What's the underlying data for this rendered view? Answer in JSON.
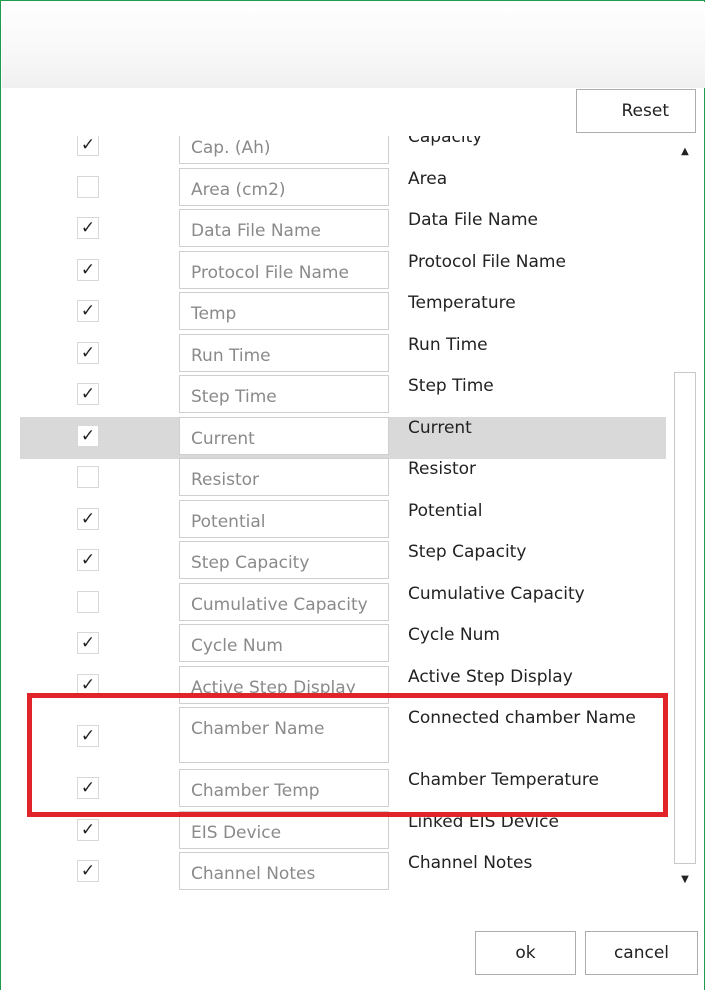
{
  "dialog": {
    "reset_label": "Reset",
    "ok_label": "ok",
    "cancel_label": "cancel"
  },
  "rows": [
    {
      "checked": true,
      "field": "Cap. (Ah)",
      "desc": "Capacity"
    },
    {
      "checked": false,
      "field": "Area (cm2)",
      "desc": "Area"
    },
    {
      "checked": true,
      "field": "Data File Name",
      "desc": "Data File Name"
    },
    {
      "checked": true,
      "field": "Protocol File Name",
      "desc": "Protocol File Name"
    },
    {
      "checked": true,
      "field": "Temp",
      "desc": "Temperature"
    },
    {
      "checked": true,
      "field": "Run Time",
      "desc": "Run Time"
    },
    {
      "checked": true,
      "field": "Step Time",
      "desc": "Step Time"
    },
    {
      "checked": true,
      "field": "Current",
      "desc": "Current",
      "selected": true
    },
    {
      "checked": false,
      "field": "Resistor",
      "desc": "Resistor"
    },
    {
      "checked": true,
      "field": "Potential",
      "desc": "Potential"
    },
    {
      "checked": true,
      "field": "Step Capacity",
      "desc": "Step Capacity"
    },
    {
      "checked": false,
      "field": "Cumulative Capacity",
      "desc": "Cumulative Capacity"
    },
    {
      "checked": true,
      "field": "Cycle Num",
      "desc": "Cycle Num"
    },
    {
      "checked": true,
      "field": "Active Step Display",
      "desc": "Active Step Display"
    },
    {
      "checked": true,
      "field": "Chamber Name",
      "desc": "Connected chamber Name",
      "tall": true
    },
    {
      "checked": true,
      "field": "Chamber Temp",
      "desc": "Chamber Temperature"
    },
    {
      "checked": true,
      "field": "EIS Device",
      "desc": "Linked EIS Device"
    },
    {
      "checked": true,
      "field": "Channel Notes",
      "desc": "Channel Notes"
    }
  ],
  "checkmark_glyph": "✓",
  "scroll": {
    "up_glyph": "▲",
    "down_glyph": "▼"
  },
  "colors": {
    "window_border": "#1e9b4f",
    "highlight": "#e0242a",
    "selected_row": "#d9d9d9"
  }
}
